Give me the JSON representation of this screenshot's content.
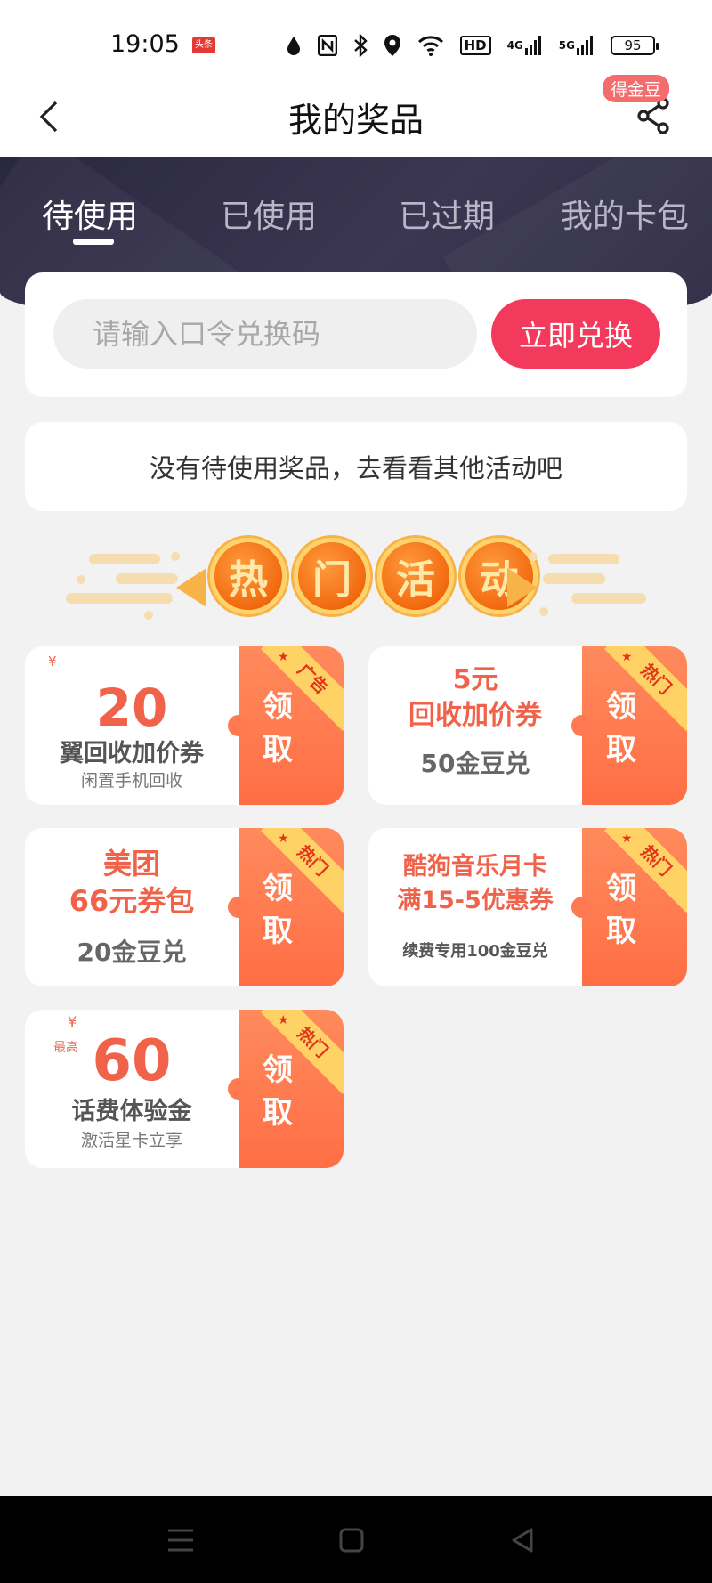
{
  "status_bar": {
    "time": "19:05",
    "app_badge": "头条",
    "network": "HD",
    "signal_4g": "4G",
    "signal_5g": "5G",
    "battery": "95"
  },
  "nav": {
    "title": "我的奖品",
    "coin_badge": "得金豆"
  },
  "tabs": [
    {
      "label": "待使用",
      "active": true
    },
    {
      "label": "已使用",
      "active": false
    },
    {
      "label": "已过期",
      "active": false
    },
    {
      "label": "我的卡包",
      "active": false
    }
  ],
  "redeem": {
    "placeholder": "请输入口令兑换码",
    "button_label": "立即兑换"
  },
  "empty_notice": "没有待使用奖品，去看看其他活动吧",
  "hot_section": {
    "chars": [
      "热",
      "门",
      "活",
      "动"
    ]
  },
  "activities": [
    {
      "yen": "¥",
      "amount": "20",
      "title": "翼回收加价券",
      "subtitle": "闲置手机回收",
      "tag": "广告",
      "claim": "领取"
    },
    {
      "line1": "5元",
      "line2": "回收加价券",
      "subtitle": "50金豆兑",
      "tag": "热门",
      "claim": "领取"
    },
    {
      "line1": "美团",
      "line2": "66元券包",
      "subtitle": "20金豆兑",
      "tag": "热门",
      "claim": "领取"
    },
    {
      "line1": "酷狗音乐月卡",
      "line2": "满15-5优惠券",
      "subtitle": "续费专用100金豆兑",
      "tag": "热门",
      "claim": "领取"
    },
    {
      "yen": "¥",
      "prefix": "最高",
      "amount": "60",
      "title": "话费体验金",
      "subtitle": "激活星卡立享",
      "tag": "热门",
      "claim": "领取"
    }
  ],
  "colors": {
    "accent": "#f43a5c",
    "header_dark": "#2a2740",
    "coupon_orange": "#ff7a50",
    "ribbon_yellow": "#ffd266",
    "price_red": "#f0624a"
  }
}
